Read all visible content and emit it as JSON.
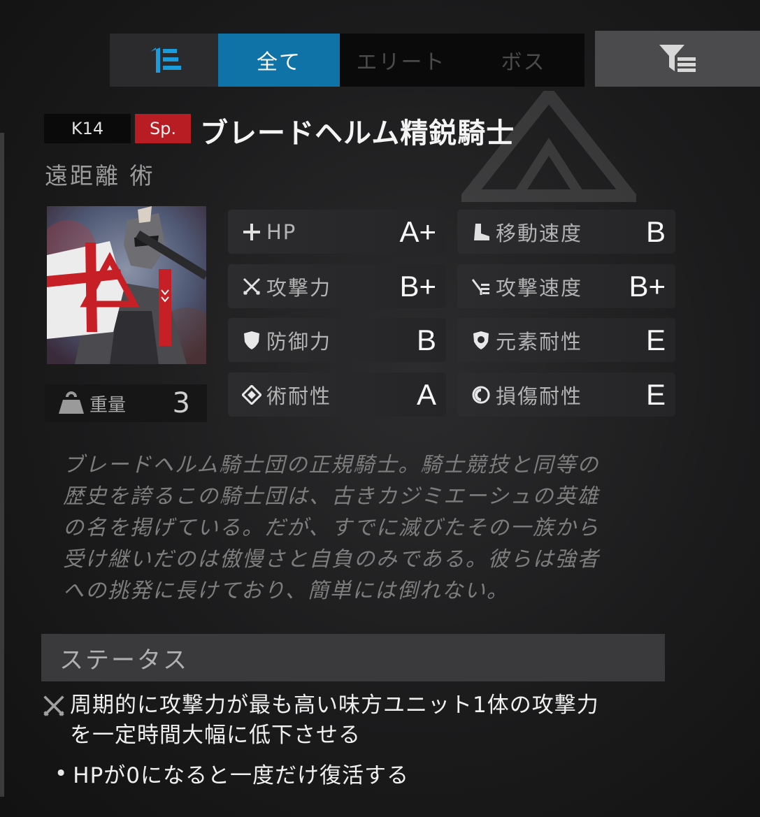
{
  "tabs": {
    "all": "全て",
    "elite": "エリート",
    "boss": "ボス"
  },
  "enemy": {
    "code": "K14",
    "tag": "Sp.",
    "name": "ブレードヘルム精鋭騎士",
    "type": "遠距離 術",
    "weight_label": "重量",
    "weight_value": "3"
  },
  "stats": [
    {
      "label": "HP",
      "grade": "A+",
      "icon": "plus-icon"
    },
    {
      "label": "移動速度",
      "grade": "B",
      "icon": "boot-icon"
    },
    {
      "label": "攻撃力",
      "grade": "B+",
      "icon": "crossed-swords-icon"
    },
    {
      "label": "攻撃速度",
      "grade": "B+",
      "icon": "speed-icon"
    },
    {
      "label": "防御力",
      "grade": "B",
      "icon": "shield-icon"
    },
    {
      "label": "元素耐性",
      "grade": "E",
      "icon": "element-shield-icon"
    },
    {
      "label": "術耐性",
      "grade": "A",
      "icon": "diamond-icon"
    },
    {
      "label": "損傷耐性",
      "grade": "E",
      "icon": "ring-icon"
    }
  ],
  "description": "ブレードヘルム騎士団の正規騎士。騎士競技と同等の\n歴史を誇るこの騎士団は、古きカジミエーシュの英雄\nの名を掲げている。だが、すでに滅びたその一族から\n受け継いだのは傲慢さと自負のみである。彼らは強者\nへの挑発に長けており、簡単には倒れない。",
  "status": {
    "title": "ステータス",
    "trait1": "周期的に攻撃力が最も高い味方ユニット1体の攻撃力\nを一定時間大幅に低下させる",
    "trait2": "HPが0になると一度だけ復活する"
  },
  "colors": {
    "accent": "#0f73a8",
    "sp_badge": "#b81d24",
    "tab_inactive_text": "#4b4b4b"
  }
}
